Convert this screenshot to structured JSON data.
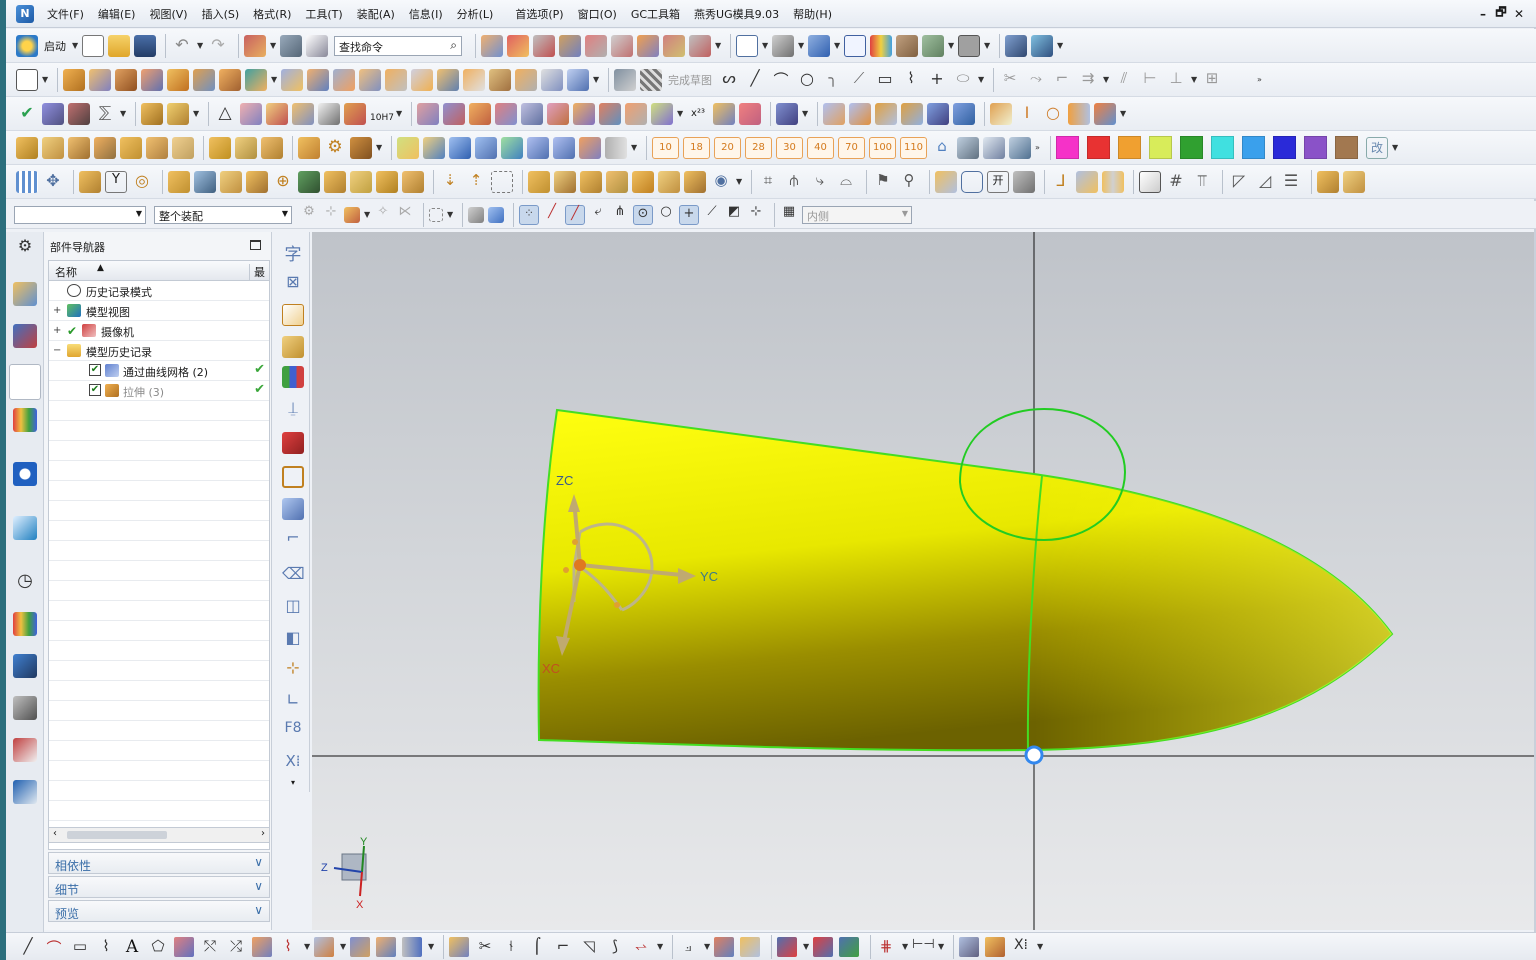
{
  "menu": {
    "items": [
      "文件(F)",
      "编辑(E)",
      "视图(V)",
      "插入(S)",
      "格式(R)",
      "工具(T)",
      "装配(A)",
      "信息(I)",
      "分析(L)",
      "首选项(P)",
      "窗口(O)",
      "GC工具箱",
      "燕秀UG模具9.03",
      "帮助(H)"
    ],
    "window_controls": [
      "–",
      "🗗",
      "✕"
    ]
  },
  "toolbar1": {
    "start_label": "启动",
    "search_placeholder": "查找命令"
  },
  "toolbar2": {
    "finish_sketch_label": "完成草图"
  },
  "toolbar3": {
    "hole_label": "10H7"
  },
  "toolbar4": {
    "number_buttons": [
      "10",
      "18",
      "20",
      "28",
      "30",
      "40",
      "70",
      "100",
      "110"
    ],
    "colors": [
      "#f532c8",
      "#e83232",
      "#f0a030",
      "#d8ec5a",
      "#30a030",
      "#40e0e0",
      "#3aa0ec",
      "#2a2ad8",
      "#8a52c8",
      "#a27850"
    ],
    "change_label": "改"
  },
  "filter_bar": {
    "type_filter": "",
    "scope_filter": "整个装配",
    "inside_filter": "内侧"
  },
  "part_navigator": {
    "title": "部件导航器",
    "col_name": "名称",
    "col_latest": "最",
    "rows": [
      {
        "label": "历史记录模式",
        "icon": "clock-icon"
      },
      {
        "label": "模型视图",
        "icon": "model-view-icon"
      },
      {
        "label": "摄像机",
        "icon": "camera-icon"
      },
      {
        "label": "模型历史记录",
        "icon": "folder-icon"
      },
      {
        "label": "通过曲线网格 (2)",
        "icon": "through-curve-mesh-icon"
      },
      {
        "label": "拉伸 (3)",
        "icon": "extrude-icon"
      }
    ],
    "panels": [
      "相依性",
      "细节",
      "预览"
    ]
  },
  "viewport": {
    "csys_labels": {
      "z": "ZC",
      "y": "YC",
      "x": "XC"
    },
    "triad_labels": {
      "z": "Z",
      "y": "Y",
      "x": "X"
    },
    "body_color": "#ffff00",
    "edge_color": "#44dd22"
  }
}
